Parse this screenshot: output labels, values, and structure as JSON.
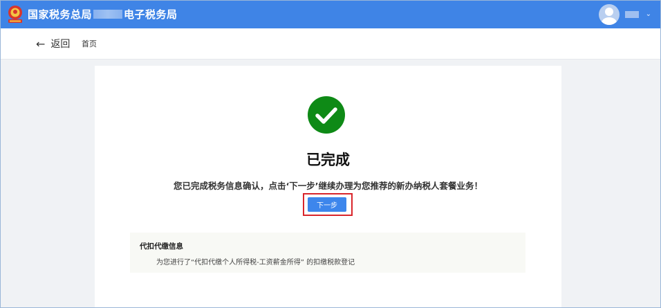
{
  "header": {
    "title_prefix": "国家税务总局",
    "title_suffix": "电子税务局",
    "colors": {
      "bar": "#3f84e6"
    },
    "emblem_icon": "national-emblem-icon",
    "avatar_icon": "user-avatar-icon"
  },
  "subnav": {
    "back_label": "返回",
    "breadcrumb": "首页"
  },
  "result": {
    "title": "已完成",
    "message": "您已完成税务信息确认，点击‘下一步’继续办理为您推荐的新办纳税人套餐业务！",
    "next_label": "下一步",
    "success_color": "#0e8a16",
    "highlight_color": "#d9252b"
  },
  "info": {
    "title": "代扣代缴信息",
    "text": "为您进行了“代扣代缴个人所得税-工资薪金所得” 的扣缴税款登记"
  }
}
